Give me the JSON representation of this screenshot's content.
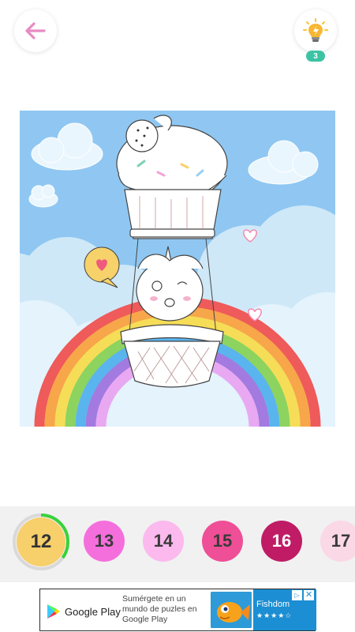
{
  "header": {
    "back_icon": "arrow-left-icon",
    "hint_icon": "lightbulb-icon",
    "hint_count": "3"
  },
  "artwork": {
    "subject": "coloring page"
  },
  "palette": {
    "items": [
      {
        "number": "12",
        "color": "#f7cf6b",
        "text_color": "#333333",
        "selected": true,
        "progress": 0.35
      },
      {
        "number": "13",
        "color": "#f56fdc",
        "text_color": "#3a3a3a"
      },
      {
        "number": "14",
        "color": "#fbb9ee",
        "text_color": "#3a3a3a"
      },
      {
        "number": "15",
        "color": "#ef4f96",
        "text_color": "#3a3a3a"
      },
      {
        "number": "16",
        "color": "#c01c66",
        "text_color": "#ffffff"
      },
      {
        "number": "17",
        "color": "#fbd8e6",
        "text_color": "#3a3a3a"
      }
    ]
  },
  "ad": {
    "store_label": "Google Play",
    "text": "Sumérgete en un mundo de puzles en Google Play",
    "app_name": "Fishdom",
    "stars": "★★★★☆",
    "info_icon": "▷",
    "close_icon": "✕"
  }
}
